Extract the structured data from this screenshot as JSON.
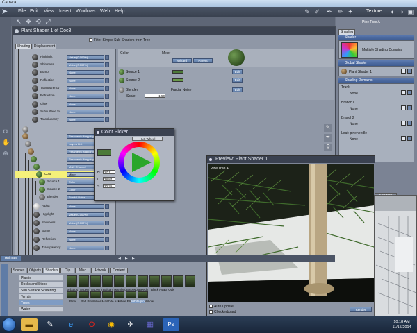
{
  "window": {
    "title": "Carrara"
  },
  "menu": [
    "File",
    "Edit",
    "View",
    "Insert",
    "Windows",
    "Web",
    "Help"
  ],
  "room_label": "Texture",
  "shader_panel": {
    "title": "Plant Shader 1 of Doc3",
    "filter_label": "Filter Simple Sub-Shaders from Tree",
    "tabs": [
      "Shading",
      "Displacement"
    ],
    "tree_rows": [
      {
        "label": "Highlight",
        "value": "Value (0.000%)"
      },
      {
        "label": "Shininess",
        "value": "Value (0.000%)"
      },
      {
        "label": "Bump",
        "value": "None"
      },
      {
        "label": "Reflection",
        "value": "None"
      },
      {
        "label": "Transparency",
        "value": "None"
      },
      {
        "label": "Refraction",
        "value": "None"
      },
      {
        "label": "Glow",
        "value": "None"
      },
      {
        "label": "Subsurface Sc",
        "value": "None"
      },
      {
        "label": "Translucency",
        "value": "None"
      },
      {
        "label": "",
        "value": ""
      },
      {
        "label": "",
        "value": "Parametric Mapping"
      },
      {
        "label": "",
        "value": "Layers List"
      },
      {
        "label": "",
        "value": "Parametric Mapping"
      },
      {
        "label": "",
        "value": "Parametric Mapping"
      },
      {
        "label": "",
        "value": "Multi Channel"
      },
      {
        "label": "Color",
        "value": "Mixer"
      },
      {
        "label": "Source 1",
        "value": "Color"
      },
      {
        "label": "Source 2",
        "value": "Color"
      },
      {
        "label": "Blender",
        "value": "Fractal Noise"
      },
      {
        "label": "Alpha",
        "value": "None"
      },
      {
        "label": "Highlight",
        "value": "Value (0.000%)"
      },
      {
        "label": "Shininess",
        "value": "Value (0.000%)"
      },
      {
        "label": "Bump",
        "value": "None"
      },
      {
        "label": "Reflection",
        "value": "None"
      },
      {
        "label": "Transparency",
        "value": "None"
      }
    ],
    "editor": {
      "color_label": "Color",
      "mixer_label": "Mixer",
      "wizard_button": "Wizard",
      "parent_button": "Parent",
      "rows": [
        {
          "label": "Source 1",
          "edit": "Edit"
        },
        {
          "label": "Source 2",
          "edit": "Edit"
        },
        {
          "label": "Blender",
          "value": "Fractal Noise",
          "edit": "Edit"
        }
      ],
      "scale_label": "Scale:",
      "scale_value": "1.50"
    }
  },
  "color_picker": {
    "title": "Color Picker",
    "mode": "HLS Wheel",
    "h_label": "H",
    "h_value": "27.11",
    "l_label": "L",
    "l_value": "38.84",
    "s_label": "S",
    "s_value": "30.36",
    "current_color": "#4c7a38"
  },
  "right_panel": {
    "tab": "Shading",
    "top_label": "Pine Tree A",
    "shader_header": "Shader",
    "shader_name": "Multiple Shading Domains",
    "global_header": "Global Shader",
    "global_value": "Plant Shader 1",
    "domains_header": "Shading Domains",
    "domains": [
      {
        "name": "Trunk",
        "value": "None"
      },
      {
        "name": "Branch1",
        "value": "None"
      },
      {
        "name": "Branch2",
        "value": "None"
      },
      {
        "name": "Leaf: pineneedle",
        "value": "None"
      }
    ],
    "shaders_tab": "Shaders"
  },
  "preview": {
    "title": "Preview: Plant Shader 1",
    "object_label": "Pine Tree A",
    "auto_update": "Auto Update",
    "checkerboard": "Checkerboard",
    "render_button": "Render"
  },
  "browser": {
    "animate_label": "Animate",
    "tabs": [
      "Scenes",
      "Objects",
      "Shaders",
      "Clip",
      "Misc",
      "Artwork",
      "Content"
    ],
    "categories": [
      "Plastic",
      "Rocks and Stone",
      "Sub Surface Scatering",
      "Terrain",
      "Trees",
      "Water"
    ],
    "thumbs_top": [
      "arbutus",
      "Aspen",
      "Aspen 2",
      "Balsam P.",
      "Bamboo",
      "Basswoo",
      "Beech",
      "Black Ash",
      "Bur Oak"
    ],
    "thumbs_bottom": [
      "Pine",
      "Red Pine",
      "Silver Ma",
      "White Asl",
      "White Elm",
      "White pin",
      "Willow"
    ]
  },
  "taskbar": {
    "time": "10:18 AM",
    "date": "11/15/2014"
  }
}
